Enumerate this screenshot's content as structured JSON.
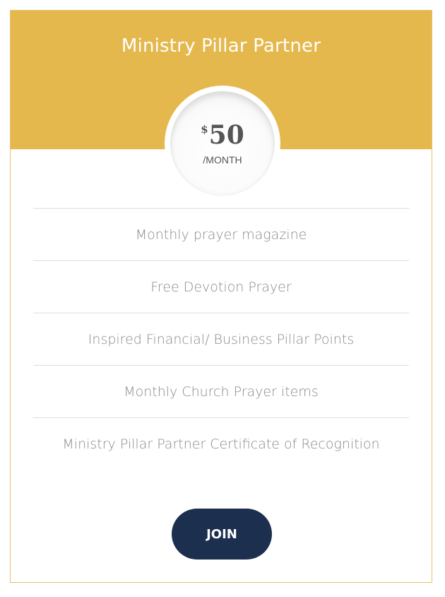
{
  "plan": {
    "title": "Ministry Pillar Partner",
    "price": {
      "currency": "$",
      "amount": "50",
      "period": "/MONTH"
    },
    "features": [
      "Monthly prayer magazine",
      "Free Devotion Prayer",
      "Inspired Financial/ Business Pillar Points",
      "Monthly Church Prayer items",
      "Ministry Pillar Partner Certificate of Recognition"
    ],
    "cta_label": "JOIN"
  },
  "colors": {
    "header": "#e4b84c",
    "button": "#1d2f4f",
    "feature_text": "#8a8a8a",
    "border": "#e2c46a"
  }
}
